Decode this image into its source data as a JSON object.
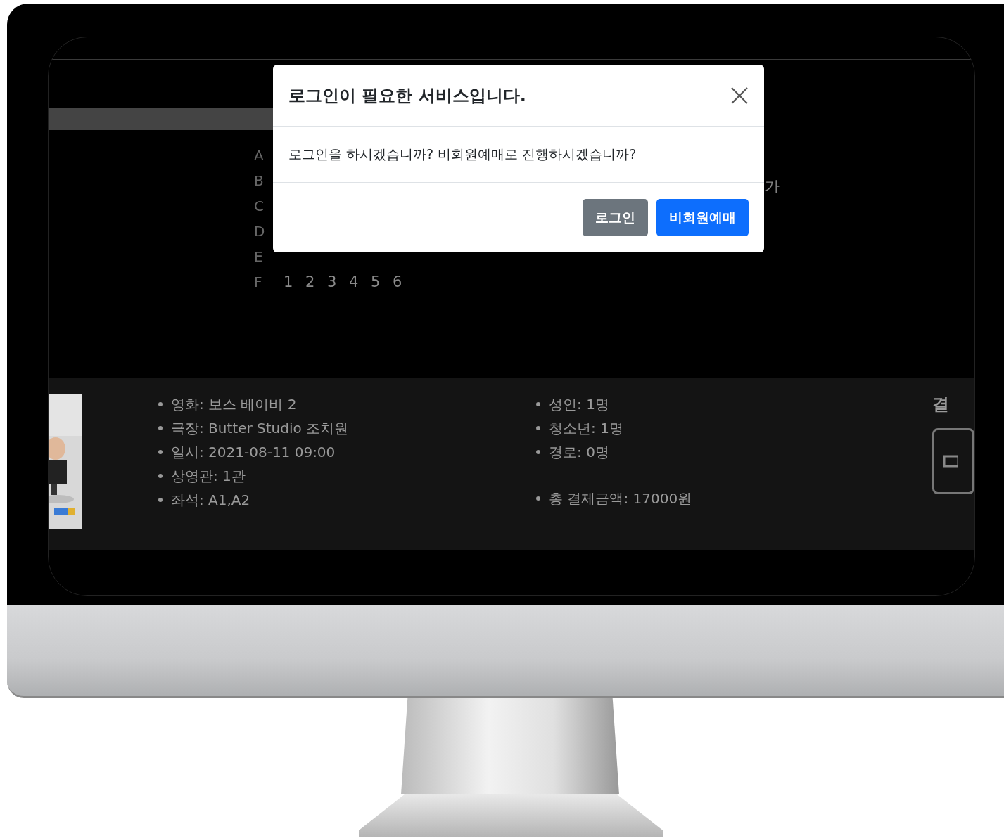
{
  "seat_map": {
    "rows": [
      {
        "label": "A",
        "seats": []
      },
      {
        "label": "B",
        "seats": []
      },
      {
        "label": "C",
        "seats": []
      },
      {
        "label": "D",
        "seats": []
      },
      {
        "label": "E",
        "seats": []
      },
      {
        "label": "F",
        "seats": [
          "1",
          "2",
          "3",
          "4",
          "5",
          "6"
        ]
      }
    ],
    "side_text": "가"
  },
  "summary": {
    "poster": {
      "kind": "picture"
    },
    "details": [
      "영화: 보스 베이비 2",
      "극장: Butter Studio 조치원",
      "일시: 2021-08-11 09:00",
      "상영관: 1관",
      "좌석: A1,A2"
    ],
    "counts": [
      "성인: 1명",
      "청소년: 1명",
      "경로: 0명"
    ],
    "total": "총 결제금액: 17000원",
    "payment_heading": "결"
  },
  "modal": {
    "title": "로그인이 필요한 서비스입니다.",
    "message": "로그인을 하시겠습니까? 비회원예매로 진행하시겠습니까?",
    "buttons": [
      {
        "label": "로그인",
        "kind": "secondary"
      },
      {
        "label": "비회원예매",
        "kind": "primary"
      }
    ]
  }
}
